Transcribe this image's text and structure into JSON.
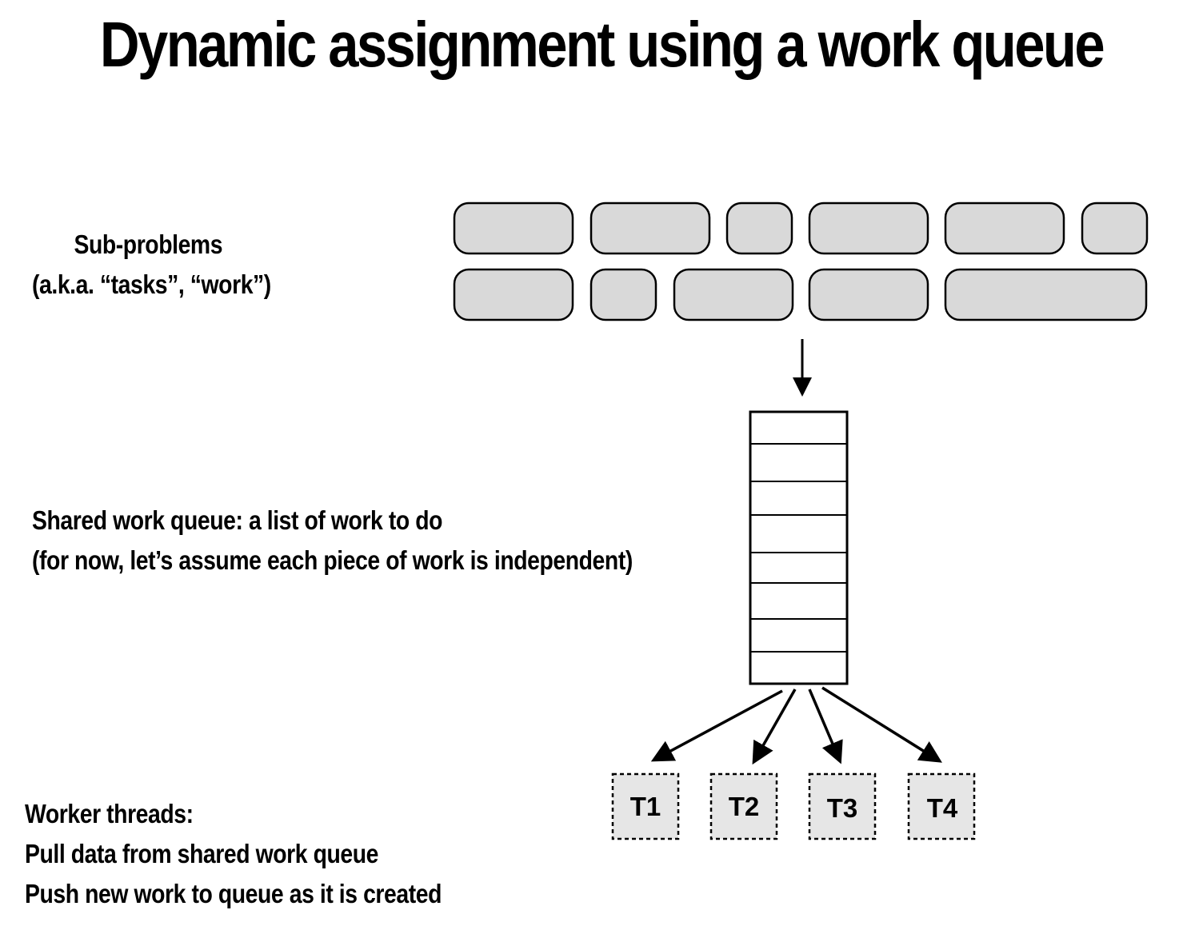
{
  "title": "Dynamic assignment using a work queue",
  "subproblems_label": {
    "line1": "Sub-problems",
    "line2": "(a.k.a. “tasks”, “work”)"
  },
  "queue_label": {
    "line1": "Shared work queue: a list of work to do",
    "line2": "(for now, let’s assume each piece of work is independent)"
  },
  "workers_label": {
    "line1": "Worker threads:",
    "line2": "Pull data from shared work queue",
    "line3": "Push new work to queue as it is created"
  },
  "threads": [
    "T1",
    "T2",
    "T3",
    "T4"
  ],
  "colors": {
    "task_fill": "#d9d9d9",
    "thread_fill": "#e6e6e6",
    "stroke": "#000000"
  }
}
